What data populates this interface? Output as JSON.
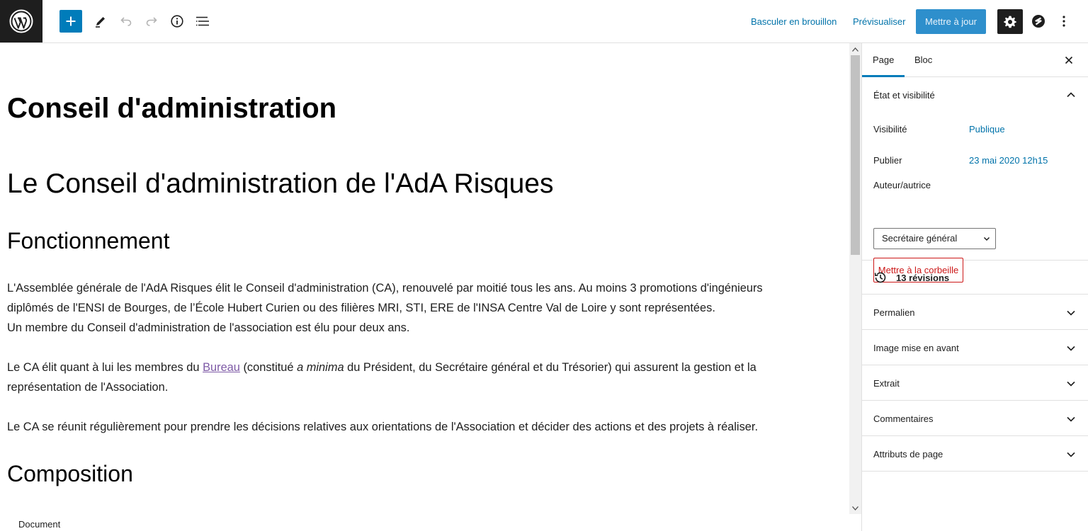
{
  "toolbar": {
    "switch_to_draft": "Basculer en brouillon",
    "preview": "Prévisualiser",
    "update": "Mettre à jour"
  },
  "content": {
    "post_title": "Conseil d'administration",
    "heading1": "Le Conseil d'administration de l'AdA Risques",
    "heading_fonctionnement": "Fonctionnement",
    "p1_line1": "L'Assemblée générale de l'AdA Risques élit le Conseil d'administration (CA), renouvelé par moitié tous les ans. Au moins 3 promotions d'ingénieurs",
    "p1_line2": "diplômés de l'ENSI de Bourges, de l’École Hubert Curien ou des filières MRI, STI, ERE de l'INSA Centre Val de Loire y sont représentées.",
    "p1_line3": "Un membre du Conseil d'administration de l'association est élu pour deux ans.",
    "p2_before_link": "Le CA élit quant à lui les membres du ",
    "p2_link": "Bureau",
    "p2_mid": " (constitué ",
    "p2_italic": "a minima",
    "p2_after": " du Président, du Secrétaire général et du Trésorier) qui assurent la gestion et la",
    "p2_line2": "représentation de l'Association.",
    "p3": "Le CA se réunit régulièrement pour prendre les décisions relatives aux orientations de l'Association et décider des actions et des projets à réaliser.",
    "heading_composition": "Composition"
  },
  "footer": {
    "breadcrumb": "Document"
  },
  "sidebar": {
    "tab_page": "Page",
    "tab_block": "Bloc",
    "status_panel": {
      "title": "État et visibilité",
      "visibility_label": "Visibilité",
      "visibility_value": "Publique",
      "publish_label": "Publier",
      "publish_value": "23 mai 2020 12h15",
      "author_label": "Auteur/autrice",
      "author_value": "Secrétaire général",
      "trash_button": "Mettre à la corbeille"
    },
    "revisions": "13 révisions",
    "panels": [
      "Permalien",
      "Image mise en avant",
      "Extrait",
      "Commentaires",
      "Attributs de page"
    ]
  },
  "colors": {
    "accent": "#007cba",
    "link": "#0073aa",
    "danger": "#cc1818",
    "visited_link": "#7e5aa6"
  },
  "icons": [
    "wordpress-logo-icon",
    "plus-icon",
    "pencil-icon",
    "undo-icon",
    "redo-icon",
    "info-icon",
    "list-view-icon",
    "gear-icon",
    "jetpack-icon",
    "more-vertical-icon",
    "close-icon",
    "chevron-up-icon",
    "chevron-down-icon",
    "history-icon"
  ]
}
